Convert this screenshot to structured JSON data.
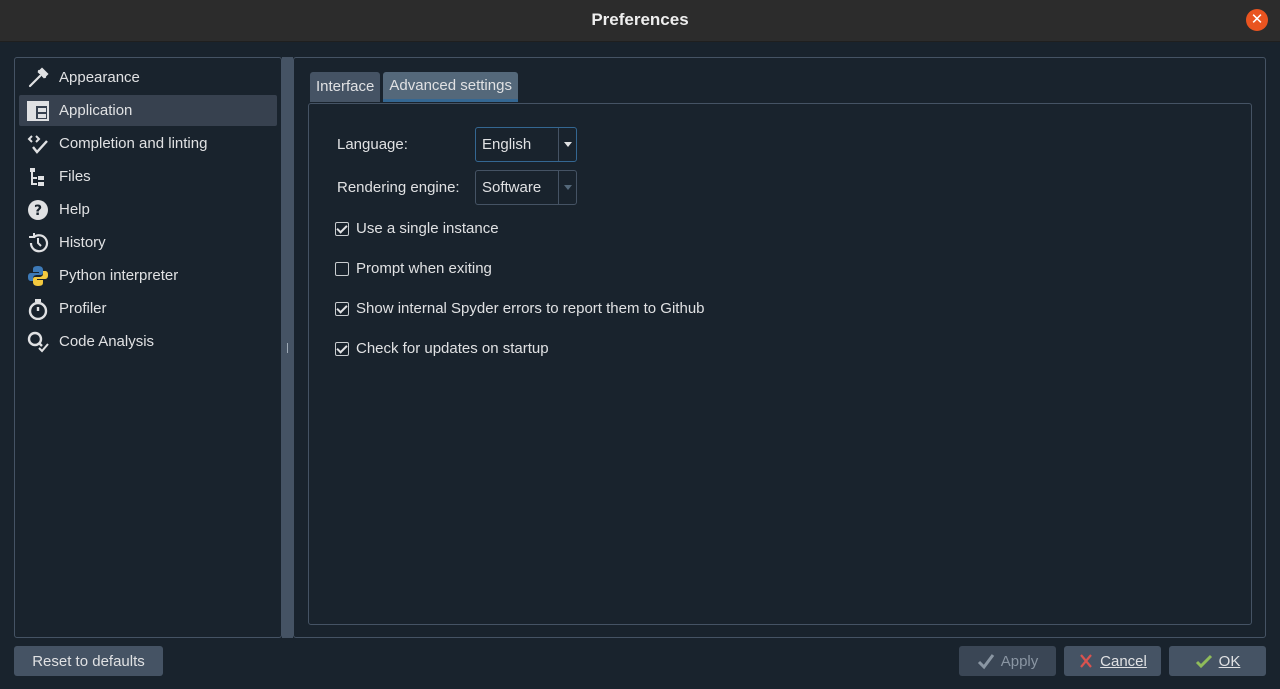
{
  "window": {
    "title": "Preferences"
  },
  "sidebar": {
    "items": [
      {
        "label": "Appearance",
        "icon": "eyedropper-icon"
      },
      {
        "label": "Application",
        "icon": "application-layout-icon"
      },
      {
        "label": "Completion and linting",
        "icon": "code-completion-icon"
      },
      {
        "label": "Files",
        "icon": "file-tree-icon"
      },
      {
        "label": "Help",
        "icon": "help-icon"
      },
      {
        "label": "History",
        "icon": "history-icon"
      },
      {
        "label": "Python interpreter",
        "icon": "python-icon"
      },
      {
        "label": "Profiler",
        "icon": "stopwatch-icon"
      },
      {
        "label": "Code Analysis",
        "icon": "code-analysis-icon"
      }
    ],
    "active_index": 1
  },
  "tabs": [
    {
      "label": "Interface"
    },
    {
      "label": "Advanced settings"
    }
  ],
  "advanced": {
    "language_label": "Language:",
    "language_value": "English",
    "rendering_label": "Rendering engine:",
    "rendering_value": "Software",
    "checks": [
      {
        "label": "Use a single instance",
        "checked": true
      },
      {
        "label": "Prompt when exiting",
        "checked": false
      },
      {
        "label": "Show internal Spyder errors to report them to Github",
        "checked": true
      },
      {
        "label": "Check for updates on startup",
        "checked": true
      }
    ]
  },
  "buttons": {
    "reset": "Reset to defaults",
    "apply": "Apply",
    "cancel": "Cancel",
    "ok": "OK"
  },
  "colors": {
    "accent": "#346792",
    "close": "#e95420"
  }
}
